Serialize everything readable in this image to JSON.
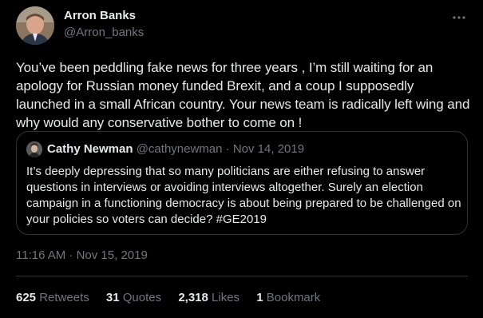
{
  "tweet": {
    "author": {
      "name": "Arron Banks",
      "handle": "@Arron_banks"
    },
    "more_icon": "more-horizontal-icon",
    "text": "You’ve been peddling fake news for three years , I’m still waiting for an apology for Russian money funded Brexit, and a coup I supposedly launched in a small African country. Your news team is radically left wing and why would any conservative bother to come on !",
    "quote": {
      "name": "Cathy Newman",
      "handle": "@cathynewman",
      "separator": " · ",
      "date": "Nov 14, 2019",
      "text": "It’s deeply depressing that so many politicians are either refusing to answer questions in interviews or avoiding interviews altogether. Surely an election campaign in a functioning democracy is about being prepared to be challenged on your policies so voters can decide? #GE2019"
    },
    "timestamp": "11:16 AM · Nov 15, 2019",
    "stats": {
      "retweets": {
        "count": "625",
        "label": "Retweets"
      },
      "quotes": {
        "count": "31",
        "label": "Quotes"
      },
      "likes": {
        "count": "2,318",
        "label": "Likes"
      },
      "bookmarks": {
        "count": "1",
        "label": "Bookmark"
      }
    }
  },
  "colors": {
    "background": "#000000",
    "text_primary": "#e7e9ea",
    "text_secondary": "#71767b",
    "border": "#2f3336"
  }
}
